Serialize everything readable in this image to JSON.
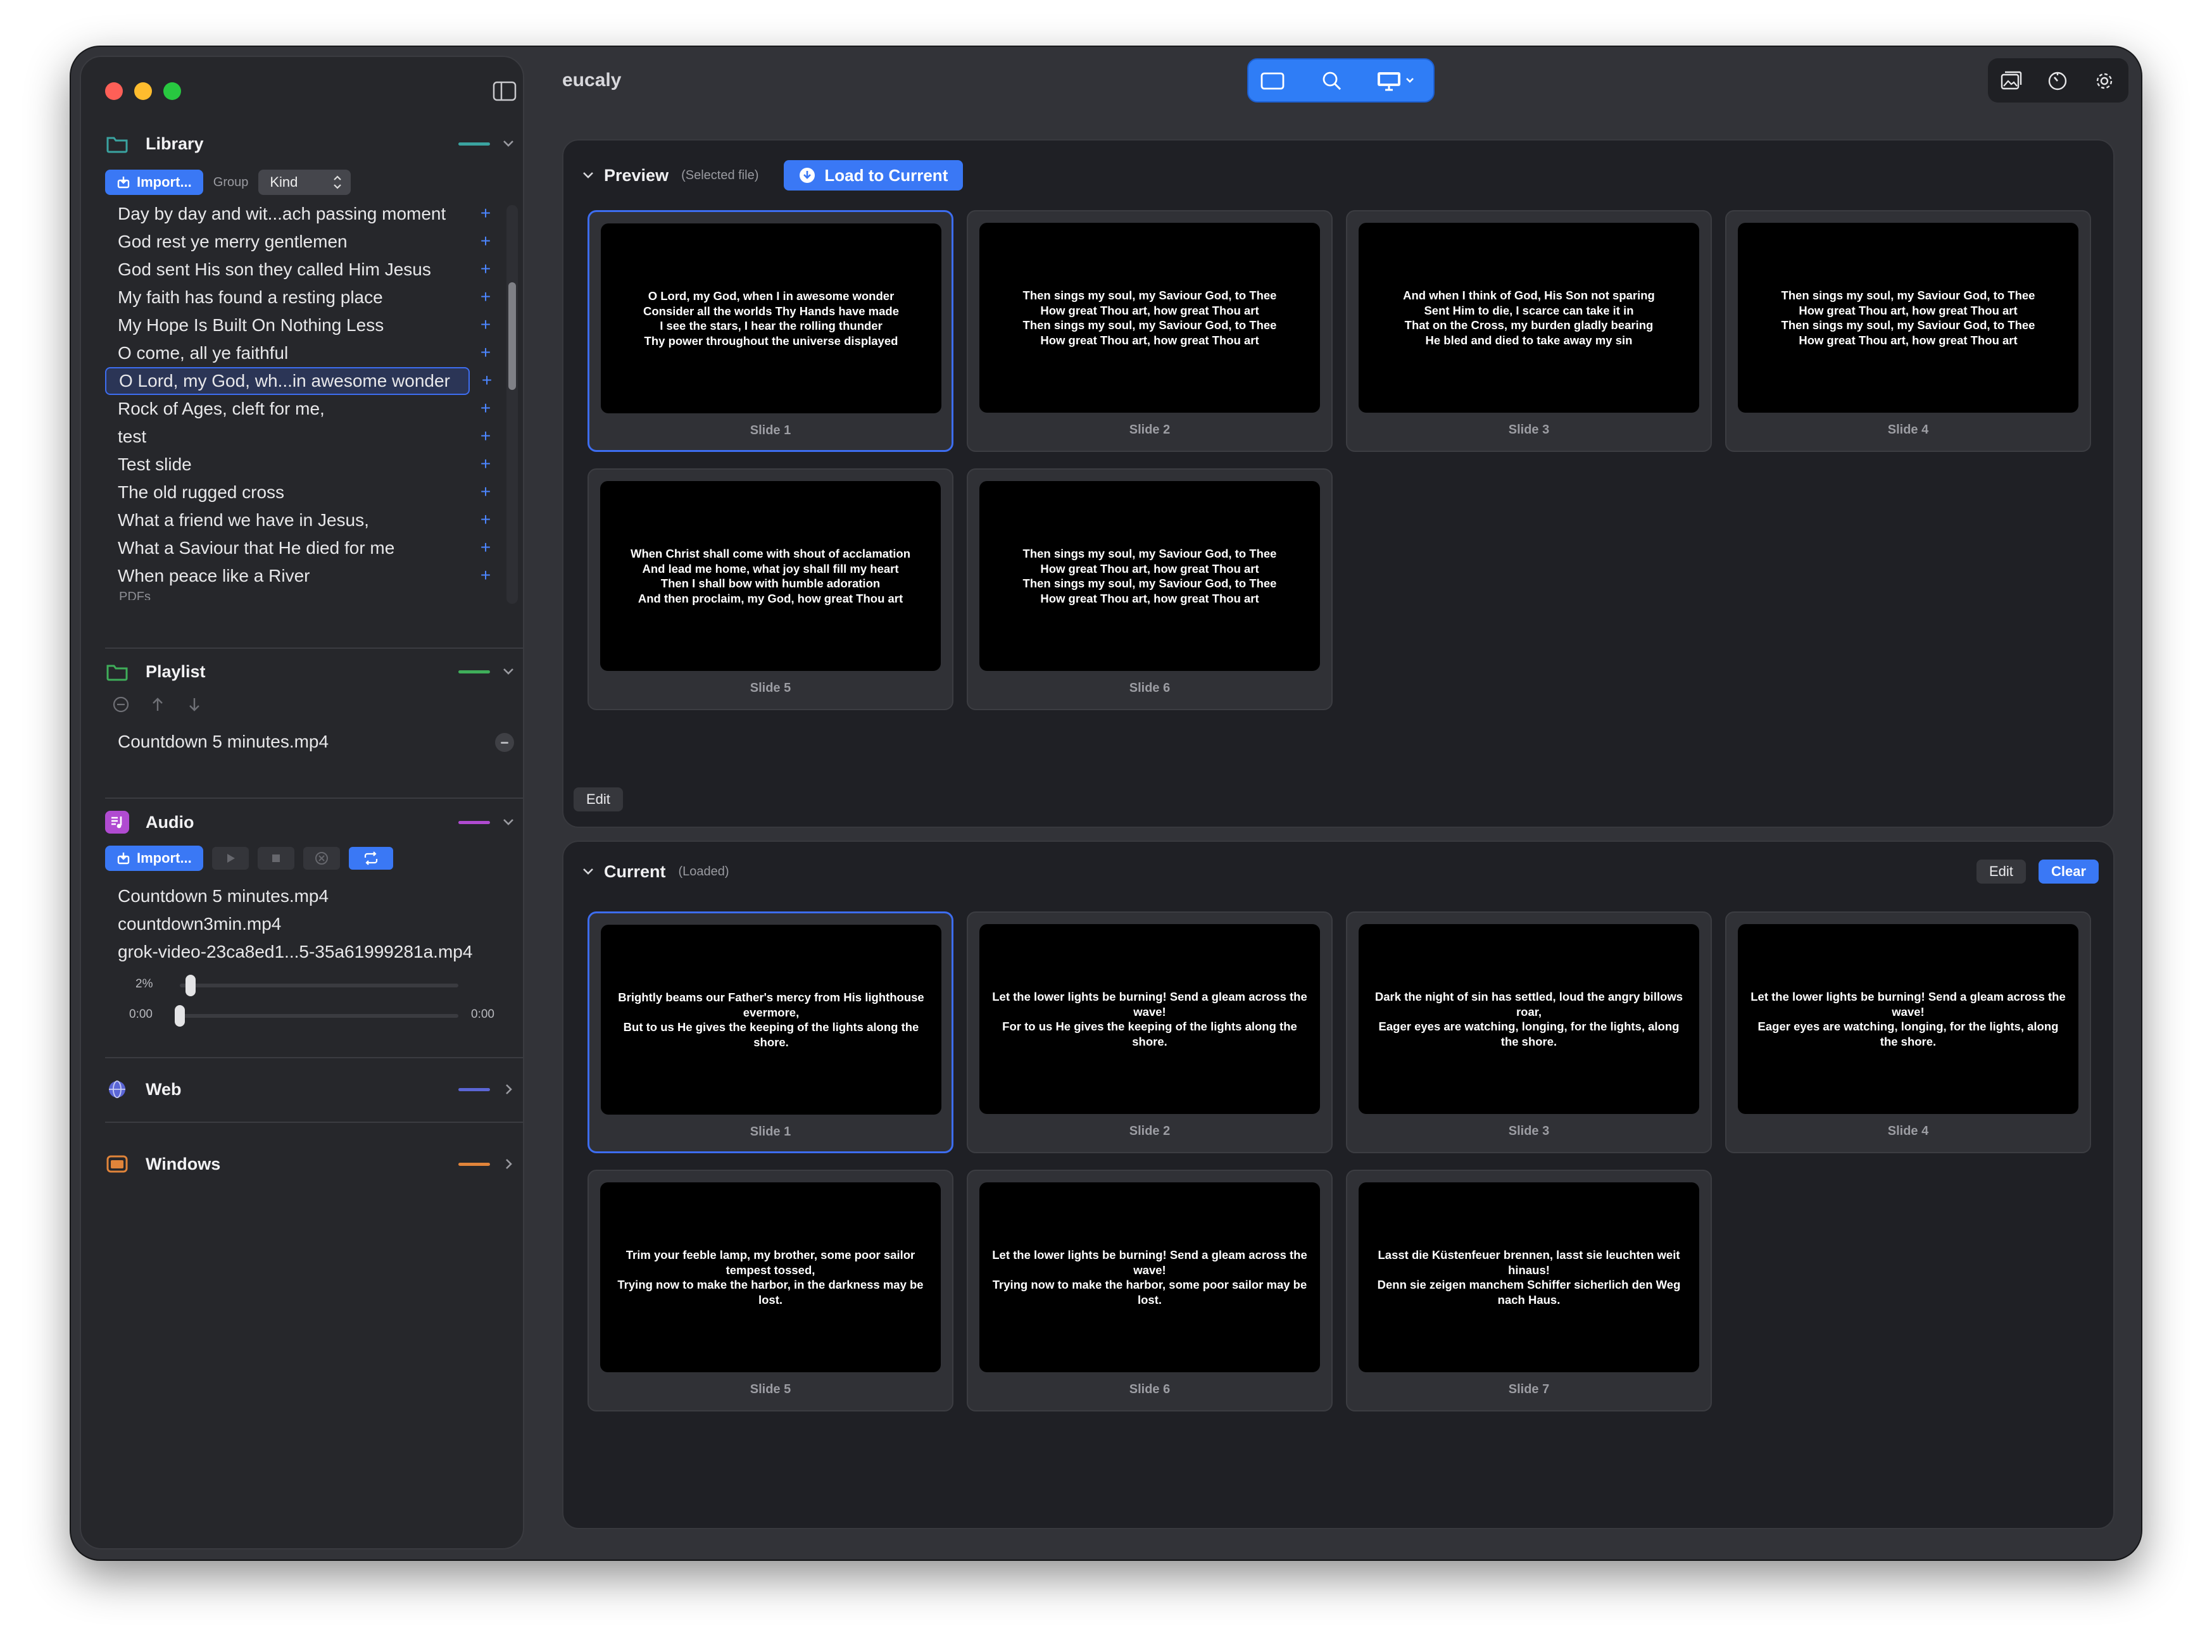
{
  "app": {
    "title": "eucaly"
  },
  "library": {
    "title": "Library",
    "import_label": "Import...",
    "group_label": "Group",
    "group_value": "Kind",
    "items": [
      "Day by day and wit...ach passing moment",
      "God rest ye merry gentlemen",
      "God sent His son they called Him Jesus",
      "My faith has found a resting place",
      "My Hope Is Built On Nothing Less",
      "O come, all ye faithful",
      "O Lord, my God, wh...in awesome wonder",
      "Rock of Ages, cleft for me,",
      "test",
      "Test slide",
      "The old rugged cross",
      "What a friend we have in Jesus,",
      "What a Saviour that He died for me",
      "When peace like a River"
    ],
    "selected_index": 6,
    "pdfs_label": "PDFs"
  },
  "playlist": {
    "title": "Playlist",
    "items": [
      "Countdown 5 minutes.mp4"
    ]
  },
  "audio": {
    "title": "Audio",
    "import_label": "Import...",
    "files": [
      "Countdown 5 minutes.mp4",
      "countdown3min.mp4",
      "grok-video-23ca8ed1...5-35a61999281a.mp4"
    ],
    "volume_label": "2%",
    "volume": 0.02,
    "time_start": "0:00",
    "time_end": "0:00",
    "progress": 0
  },
  "web": {
    "title": "Web"
  },
  "windows": {
    "title": "Windows"
  },
  "preview": {
    "title": "Preview",
    "subtitle": "(Selected file)",
    "load_label": "Load to Current",
    "edit_label": "Edit",
    "slides": [
      {
        "label": "Slide 1",
        "text": "O Lord, my God, when I in awesome wonder\nConsider all the worlds Thy Hands have made\nI see the stars, I hear the rolling thunder\nThy power throughout the universe displayed",
        "selected": true
      },
      {
        "label": "Slide 2",
        "text": "Then sings my soul, my Saviour God, to Thee\nHow great Thou art, how great Thou art\nThen sings my soul, my Saviour God, to Thee\nHow great Thou art, how great Thou art",
        "selected": false
      },
      {
        "label": "Slide 3",
        "text": "And when I think of God, His Son not sparing\nSent Him to die, I scarce can take it in\nThat on the Cross, my burden gladly bearing\nHe bled and died to take away my sin",
        "selected": false
      },
      {
        "label": "Slide 4",
        "text": "Then sings my soul, my Saviour God, to Thee\nHow great Thou art, how great Thou art\nThen sings my soul, my Saviour God, to Thee\nHow great Thou art, how great Thou art",
        "selected": false
      },
      {
        "label": "Slide 5",
        "text": "When Christ shall come with shout of acclamation\nAnd lead me home, what joy shall fill my heart\nThen I shall bow with humble adoration\nAnd then proclaim, my God, how great Thou art",
        "selected": false
      },
      {
        "label": "Slide 6",
        "text": "Then sings my soul, my Saviour God, to Thee\nHow great Thou art, how great Thou art\nThen sings my soul, my Saviour God, to Thee\nHow great Thou art, how great Thou art",
        "selected": false
      }
    ]
  },
  "current": {
    "title": "Current",
    "subtitle": "(Loaded)",
    "edit_label": "Edit",
    "clear_label": "Clear",
    "slides": [
      {
        "label": "Slide 1",
        "text": "Brightly beams our Father's mercy from His lighthouse evermore,\nBut to us He gives the keeping of the lights along the shore.",
        "selected": true
      },
      {
        "label": "Slide 2",
        "text": "Let the lower lights be burning! Send a gleam across the wave!\nFor to us He gives the keeping of the lights along the shore.",
        "selected": false
      },
      {
        "label": "Slide 3",
        "text": "Dark the night of sin has settled, loud the angry billows roar,\nEager eyes are watching, longing, for the lights, along the shore.",
        "selected": false
      },
      {
        "label": "Slide 4",
        "text": "Let the lower lights be burning! Send a gleam across the wave!\nEager eyes are watching, longing, for the lights, along the shore.",
        "selected": false
      },
      {
        "label": "Slide 5",
        "text": "Trim your feeble lamp, my brother, some poor sailor tempest tossed,\nTrying now to make the harbor, in the darkness may be lost.",
        "selected": false
      },
      {
        "label": "Slide 6",
        "text": "Let the lower lights be burning! Send a gleam across the wave!\nTrying now to make the harbor, some poor sailor may be lost.",
        "selected": false
      },
      {
        "label": "Slide 7",
        "text": "Lasst die Küstenfeuer brennen, lasst sie leuchten weit hinaus!\nDenn sie zeigen manchem Schiffer sicherlich den Weg nach Haus.",
        "selected": false
      }
    ]
  },
  "colors": {
    "accent": "#3a78f5",
    "library": "#3aa3a0",
    "playlist": "#3fae5a",
    "audio": "#b04bd1",
    "web": "#5b66d6",
    "windows": "#e0843a"
  },
  "icons": {
    "sidebar_toggle": "sidebar-icon",
    "toolbar": [
      "rectangle-icon",
      "magnifier-icon",
      "display-icon"
    ],
    "right_tools": [
      "photos-icon",
      "timer-icon",
      "gear-icon"
    ]
  }
}
